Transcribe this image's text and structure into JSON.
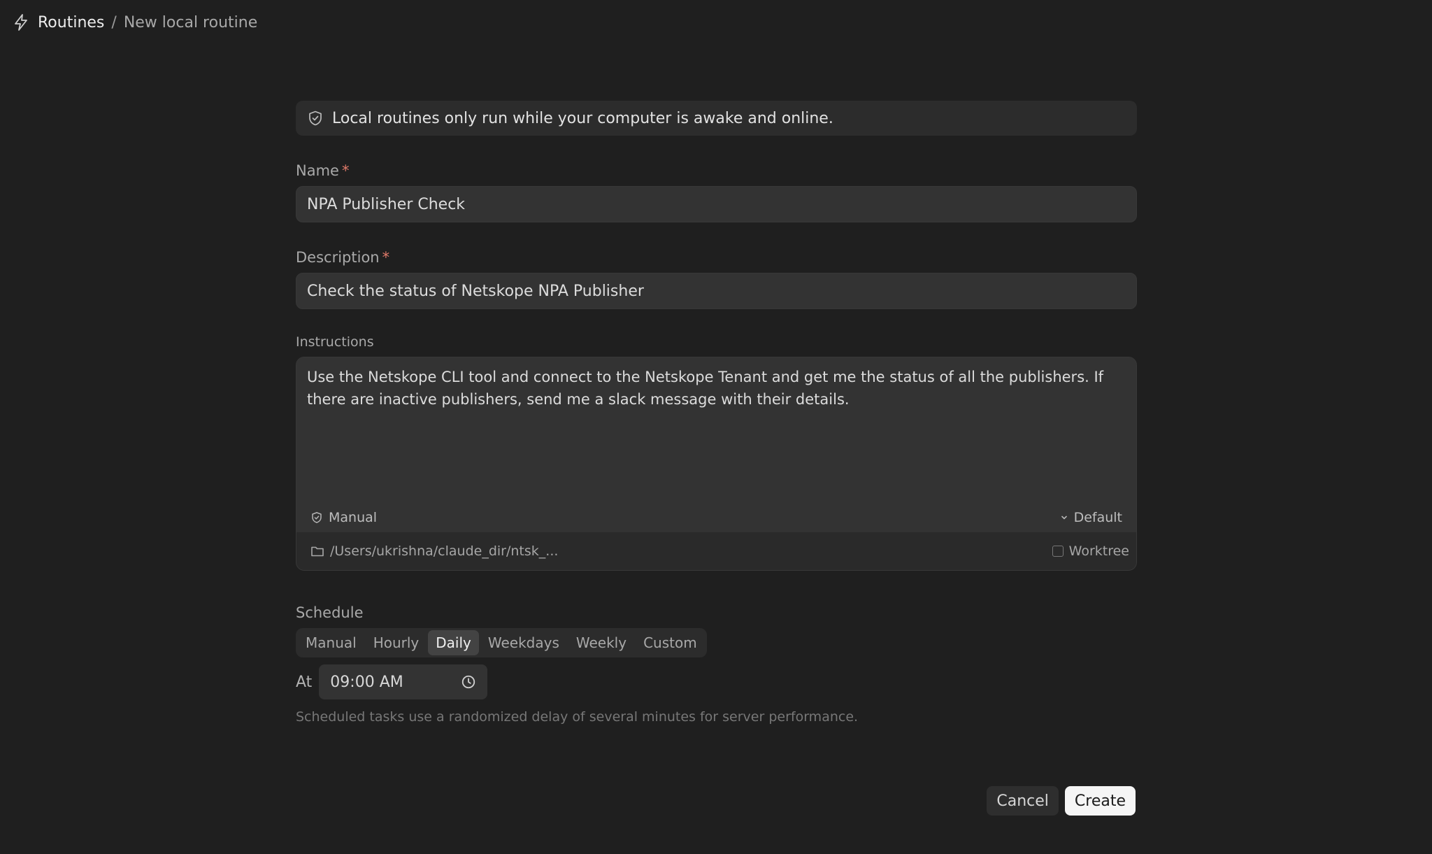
{
  "breadcrumb": {
    "root": "Routines",
    "separator": "/",
    "current": "New local routine"
  },
  "notice": {
    "text": "Local routines only run while your computer is awake and online."
  },
  "name": {
    "label": "Name",
    "required_mark": "*",
    "value": "NPA Publisher Check"
  },
  "description": {
    "label": "Description",
    "required_mark": "*",
    "value": "Check the status of Netskope NPA Publisher"
  },
  "instructions": {
    "label": "Instructions",
    "value": "Use the Netskope CLI tool and connect to the Netskope Tenant and get me the status of all the publishers. If there are inactive publishers, send me a slack message with their details.",
    "permission_mode": "Manual",
    "model": "Default",
    "directory": "/Users/ukrishna/claude_dir/ntsk_...",
    "worktree_label": "Worktree"
  },
  "schedule": {
    "label": "Schedule",
    "options": [
      "Manual",
      "Hourly",
      "Daily",
      "Weekdays",
      "Weekly",
      "Custom"
    ],
    "selected": "Daily",
    "at_label": "At",
    "time_value": "09:00 AM",
    "hint": "Scheduled tasks use a randomized delay of several minutes for server performance."
  },
  "actions": {
    "cancel_label": "Cancel",
    "create_label": "Create"
  },
  "colors": {
    "background": "#1f1f1f",
    "field": "#333333",
    "required": "#e07a6a",
    "primary_button": "#f5f5f5"
  }
}
